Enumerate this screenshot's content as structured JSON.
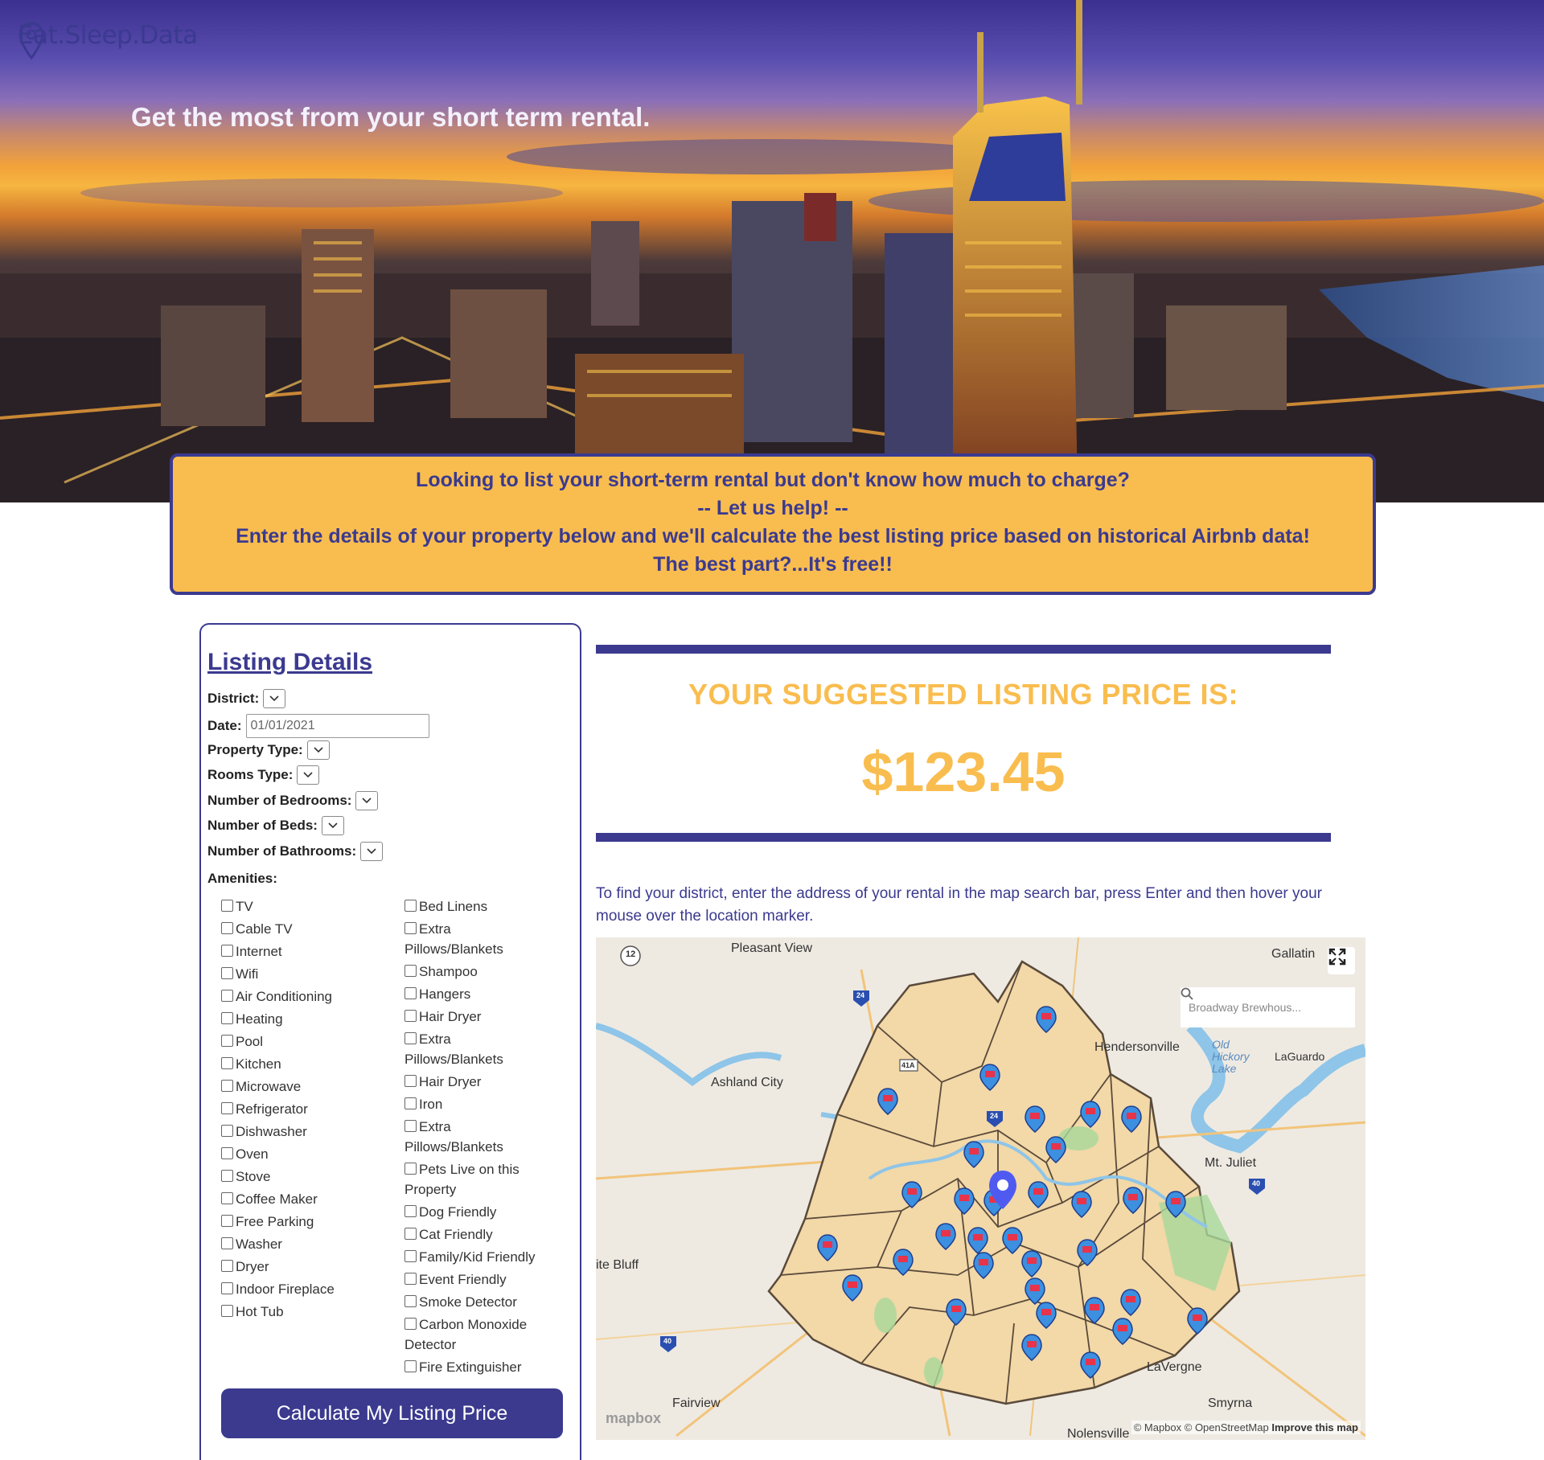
{
  "brand": {
    "name": "Eat.Sleep.Data"
  },
  "hero": {
    "tagline": "Get the most from your short term rental."
  },
  "banner": {
    "line1": "Looking to list your short-term rental but don't know how much to charge?",
    "line2": "-- Let us help! --",
    "line3": "Enter the details of your property below and we'll calculate the best listing price based on historical Airbnb data!",
    "line4": "The best part?...It's free!!"
  },
  "form": {
    "title": "Listing Details",
    "district_label": "District:",
    "date_label": "Date:",
    "date_value": "01/01/2021",
    "property_type_label": "Property Type:",
    "rooms_type_label": "Rooms Type:",
    "bedrooms_label": "Number of Bedrooms:",
    "beds_label": "Number of Beds:",
    "bathrooms_label": "Number of Bathrooms:",
    "amenities_label": "Amenities:",
    "amenities_left": [
      "TV",
      "Cable TV",
      "Internet",
      "Wifi",
      "Air Conditioning",
      "Heating",
      "Pool",
      "Kitchen",
      "Microwave",
      "Refrigerator",
      "Dishwasher",
      "Oven",
      "Stove",
      "Coffee Maker",
      "Free Parking",
      "Washer",
      "Dryer",
      "Indoor Fireplace",
      "Hot Tub"
    ],
    "amenities_right": [
      "Bed Linens",
      "Extra Pillows/Blankets",
      "Shampoo",
      "Hangers",
      "Hair Dryer",
      "Extra Pillows/Blankets",
      "Hair Dryer",
      "Iron",
      "Extra Pillows/Blankets",
      "Pets Live on this Property",
      "Dog Friendly",
      "Cat Friendly",
      "Family/Kid Friendly",
      "Event Friendly",
      "Smoke Detector",
      "Carbon Monoxide Detector",
      "Fire Extinguisher"
    ],
    "submit_label": "Calculate My Listing Price"
  },
  "result": {
    "heading": "YOUR SUGGESTED LISTING PRICE IS:",
    "price": "$123.45",
    "instructions": "To find your district, enter the address of your rental in the map search bar, press Enter and then hover your mouse over the location marker."
  },
  "map": {
    "search_value": "Broadway Brewhous...",
    "places": [
      "Pleasant View",
      "Gallatin",
      "Hendersonville",
      "Old Hickory Lake",
      "LaGuardo",
      "Ashland City",
      "Mt. Juliet",
      "ite Bluff",
      "LaVergne",
      "Fairview",
      "Smyrna",
      "Nolensville"
    ],
    "route_shields": [
      "12",
      "24",
      "41A",
      "24",
      "40",
      "40"
    ],
    "logo": "mapbox",
    "attribution": "© Mapbox © OpenStreetMap",
    "improve_link": "Improve this map"
  },
  "colors": {
    "brand": "#3b3a8f",
    "accent": "#f9bd4f"
  }
}
